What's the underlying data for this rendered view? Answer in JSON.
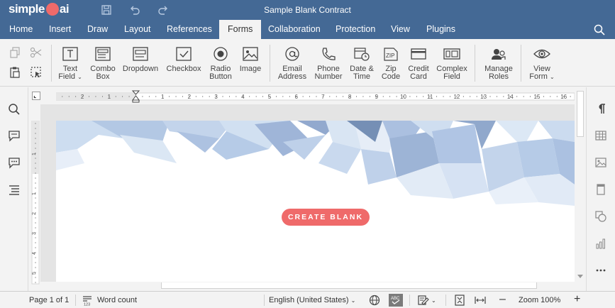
{
  "app": {
    "logo_left": "simple",
    "logo_right": "ai",
    "title": "Sample Blank Contract"
  },
  "tabs": [
    {
      "label": "Home"
    },
    {
      "label": "Insert"
    },
    {
      "label": "Draw"
    },
    {
      "label": "Layout"
    },
    {
      "label": "References"
    },
    {
      "label": "Forms",
      "active": true
    },
    {
      "label": "Collaboration"
    },
    {
      "label": "Protection"
    },
    {
      "label": "View"
    },
    {
      "label": "Plugins"
    }
  ],
  "ribbon": {
    "text_field": [
      "Text",
      "Field"
    ],
    "combo_box": [
      "Combo",
      "Box"
    ],
    "dropdown": "Dropdown",
    "checkbox": "Checkbox",
    "radio_button": [
      "Radio",
      "Button"
    ],
    "image": "Image",
    "email_address": [
      "Email",
      "Address"
    ],
    "phone_number": [
      "Phone",
      "Number"
    ],
    "date_time": [
      "Date &",
      "Time"
    ],
    "zip_code": [
      "Zip",
      "Code"
    ],
    "credit_card": [
      "Credit",
      "Card"
    ],
    "complex_field": [
      "Complex",
      "Field"
    ],
    "manage_roles": [
      "Manage",
      "Roles"
    ],
    "view_form": [
      "View",
      "Form"
    ]
  },
  "document": {
    "create_button": "CREATE BLANK"
  },
  "ruler": {
    "ticks": [
      "2",
      "1",
      "1",
      "2",
      "3",
      "4",
      "5",
      "6",
      "7",
      "8",
      "9",
      "10",
      "11",
      "12",
      "13",
      "14",
      "15",
      "16"
    ],
    "vticks": [
      "1",
      "1",
      "2",
      "3",
      "4",
      "5",
      "6",
      "7",
      "8"
    ]
  },
  "status": {
    "page": "Page 1 of 1",
    "word_count": "Word count",
    "language": "English (United States)",
    "zoom": "Zoom 100%",
    "spell_badge": "ABC"
  },
  "colors": {
    "header": "#446995",
    "accent": "#ef6a6a"
  }
}
